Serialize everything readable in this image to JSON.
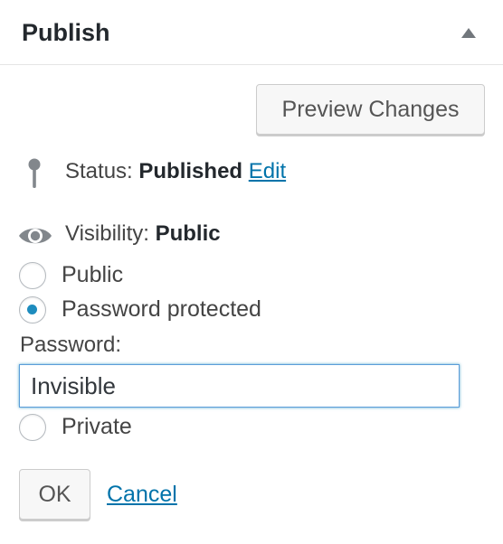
{
  "header": {
    "title": "Publish",
    "toggle_icon": "triangle-up-icon"
  },
  "actions": {
    "preview_label": "Preview Changes"
  },
  "status": {
    "icon": "map-pin-icon",
    "label": "Status:",
    "value": "Published",
    "edit_label": "Edit"
  },
  "visibility": {
    "icon": "eye-icon",
    "label": "Visibility:",
    "value": "Public",
    "options": [
      {
        "label": "Public",
        "checked": false
      },
      {
        "label": "Password protected",
        "checked": true
      },
      {
        "label": "Private",
        "checked": false
      }
    ],
    "password_label": "Password:",
    "password_value": "Invisible"
  },
  "footer": {
    "ok_label": "OK",
    "cancel_label": "Cancel"
  },
  "colors": {
    "link": "#0073aa",
    "radio_dot": "#1e8cbe",
    "focus_border": "#5b9dd9",
    "text": "#23282d",
    "icon": "#82878c"
  }
}
